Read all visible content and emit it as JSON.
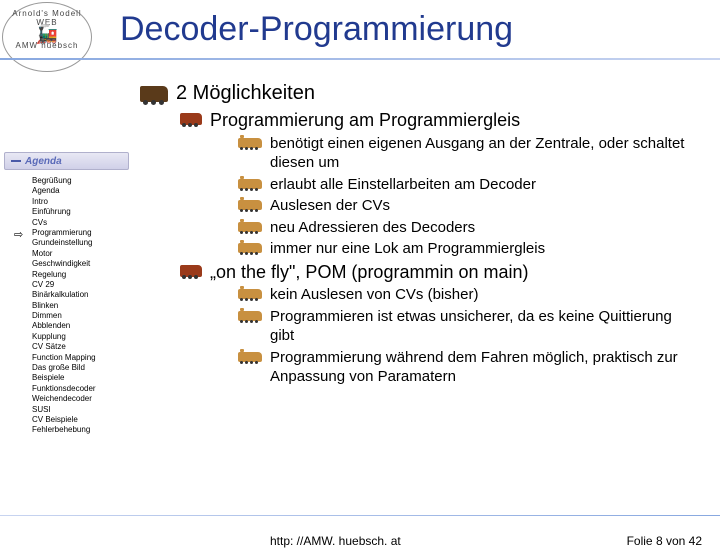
{
  "logo": {
    "top_arc": "Arnold's Modell WEB",
    "bottom_arc": "AMW huebsch"
  },
  "title": "Decoder-Programmierung",
  "content": {
    "l1": "2 Möglichkeiten",
    "sectionA": {
      "head": "Programmierung am Programmiergleis",
      "items": [
        "benötigt einen eigenen Ausgang an der Zentrale, oder schaltet diesen um",
        "erlaubt alle Einstellarbeiten am Decoder",
        "Auslesen der CVs",
        "neu Adressieren des Decoders",
        "immer nur eine Lok am Programmiergleis"
      ]
    },
    "sectionB": {
      "head": "„on the fly\", POM (programmin on main)",
      "items": [
        "kein Auslesen von CVs (bisher)",
        "Programmieren ist etwas unsicherer, da es keine Quittierung gibt",
        "Programmierung während dem Fahren möglich, praktisch zur Anpassung von Paramatern"
      ]
    }
  },
  "sidebar": {
    "head": "Agenda",
    "current_index": 5,
    "items": [
      "Begrüßung",
      "Agenda",
      "Intro",
      "Einführung",
      "CVs",
      "Programmierung",
      "Grundeinstellung",
      "Motor",
      "Geschwindigkeit",
      "Regelung",
      "CV 29",
      "Binärkalkulation",
      "Blinken",
      "Dimmen",
      "Abblenden",
      "Kupplung",
      "CV Sätze",
      "Function Mapping",
      "Das große Bild",
      "Beispiele",
      "Funktionsdecoder",
      "Weichendecoder",
      "SUSI",
      "CV Beispiele",
      "Fehlerbehebung"
    ]
  },
  "footer": {
    "url": "http: //AMW. huebsch. at",
    "page_prefix": "Folie ",
    "page_current": "8",
    "page_sep": " von ",
    "page_total": "42"
  }
}
